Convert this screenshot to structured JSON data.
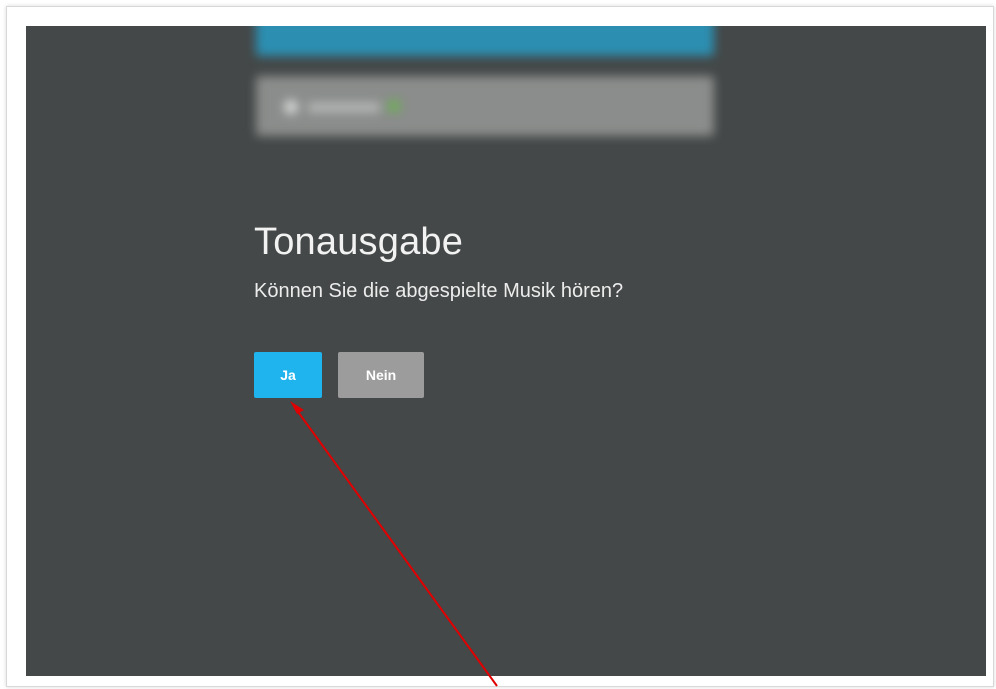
{
  "dialog": {
    "title": "Tonausgabe",
    "question": "Können Sie die abgespielte Musik hören?",
    "yes_label": "Ja",
    "no_label": "Nein"
  },
  "colors": {
    "screen_background": "#444848",
    "yes_button": "#1fb4ee",
    "no_button": "#9c9c9c",
    "annotation_arrow": "#e00000",
    "blurred_primary": "#2c8fb2",
    "blurred_secondary": "#8a8d8b",
    "blurred_check": "#6fae58"
  },
  "annotation": {
    "type": "arrow",
    "points_to": "yes-button"
  }
}
